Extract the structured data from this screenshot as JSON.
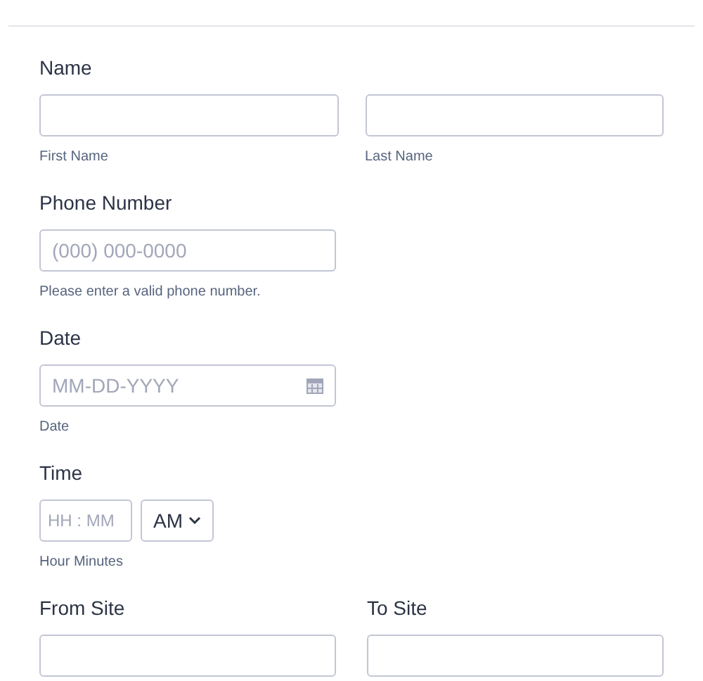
{
  "fields": [
    {
      "kind": "name",
      "label": "Name",
      "sublabels": [
        "First Name",
        "Last Name"
      ]
    },
    {
      "kind": "phone",
      "label": "Phone Number",
      "placeholder": "(000) 000-0000",
      "help": "Please enter a valid phone number."
    },
    {
      "kind": "date",
      "label": "Date",
      "placeholder": "MM-DD-YYYY",
      "help": "Date"
    },
    {
      "kind": "time",
      "label": "Time",
      "placeholder": "HH : MM",
      "period": "AM",
      "help": "Hour Minutes"
    },
    {
      "kind": "pair",
      "labels": [
        "From Site",
        "To Site"
      ]
    }
  ]
}
